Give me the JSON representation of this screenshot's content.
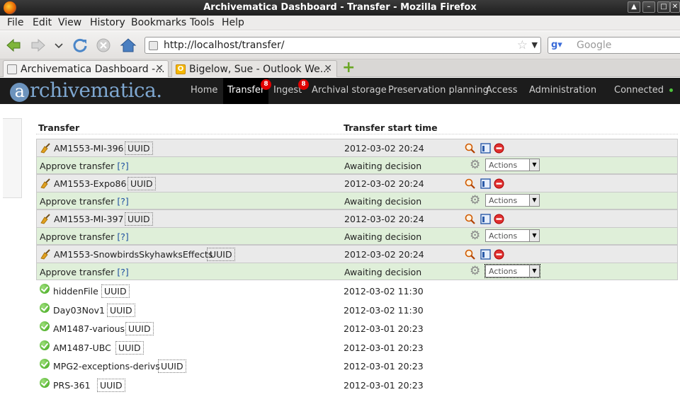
{
  "window": {
    "title": "Archivematica Dashboard - Transfer - Mozilla Firefox",
    "buttons": [
      "▲",
      "–",
      "□",
      "✕"
    ]
  },
  "menu": [
    "File",
    "Edit",
    "View",
    "History",
    "Bookmarks",
    "Tools",
    "Help"
  ],
  "navbar": {
    "url": "http://localhost/transfer/",
    "search_placeholder": "Google"
  },
  "tabs": [
    {
      "label": "Archivematica Dashboard -...",
      "close": "✕",
      "icon": "page-icon"
    },
    {
      "label": "Bigelow, Sue - Outlook We...",
      "close": "✕",
      "icon": "outlook-icon"
    }
  ],
  "app": {
    "logo": "rchivematica.",
    "logo_a": "a",
    "nav": [
      {
        "label": "Home"
      },
      {
        "label": "Transfer",
        "badge": "8"
      },
      {
        "label": "Ingest",
        "badge": "8"
      },
      {
        "label": "Archival storage"
      },
      {
        "label": "Preservation planning"
      },
      {
        "label": "Access"
      },
      {
        "label": "Administration"
      }
    ],
    "status": "Connected"
  },
  "table": {
    "headers": {
      "transfer": "Transfer",
      "start": "Transfer start time"
    },
    "uuid_label": "UUID",
    "action_select_label": "Actions",
    "help_label": "[?]",
    "active_transfers": [
      {
        "name": "AM1553-MI-396",
        "time": "2012-03-02 20:24",
        "job": "Approve transfer",
        "status": "Awaiting decision"
      },
      {
        "name": "AM1553-Expo86",
        "time": "2012-03-02 20:24",
        "job": "Approve transfer",
        "status": "Awaiting decision"
      },
      {
        "name": "AM1553-MI-397",
        "time": "2012-03-02 20:24",
        "job": "Approve transfer",
        "status": "Awaiting decision"
      },
      {
        "name": "AM1553-SnowbirdsSkyhawksEffects",
        "time": "2012-03-02 20:24",
        "job": "Approve transfer",
        "status": "Awaiting decision"
      }
    ],
    "completed_transfers": [
      {
        "name": "hiddenFile",
        "time": "2012-03-02 11:30"
      },
      {
        "name": "Day03Nov1",
        "time": "2012-03-02 11:30"
      },
      {
        "name": "AM1487-various",
        "time": "2012-03-01 20:23"
      },
      {
        "name": "AM1487-UBC",
        "time": "2012-03-01 20:23"
      },
      {
        "name": "MPG2-exceptions-derivs",
        "time": "2012-03-01 20:23"
      },
      {
        "name": "PRS-361",
        "time": "2012-03-01 20:23"
      }
    ]
  }
}
